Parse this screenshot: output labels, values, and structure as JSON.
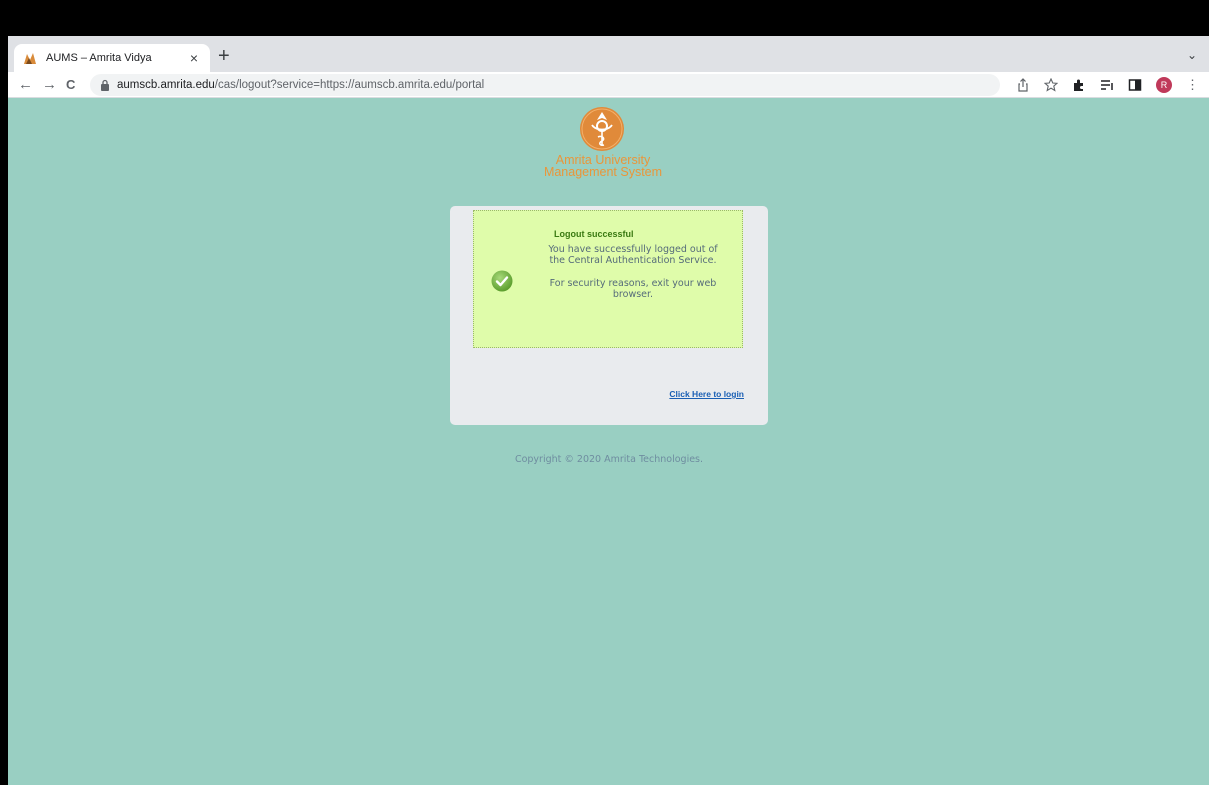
{
  "browser": {
    "tab": {
      "title": "AUMS – Amrita Vidya",
      "close": "×"
    },
    "new_tab": "+",
    "tab_list": "⌄",
    "nav": {
      "back": "←",
      "forward": "→",
      "reload": "C"
    },
    "url": {
      "domain": "aumscb.amrita.edu",
      "path": "/cas/logout?service=https://aumscb.amrita.edu/portal"
    },
    "toolbar_icons": [
      "share-icon",
      "star-icon",
      "extensions-icon",
      "reading-list-icon",
      "side-panel-icon",
      "profile-avatar",
      "menu-icon"
    ],
    "profile_initial": "R"
  },
  "page": {
    "background": "#99cfc2",
    "brand_line1": "Amrita University",
    "brand_line2": "Management System",
    "status": {
      "title": "Logout successful",
      "message": "You have successfully logged out of the Central Authentication Service.",
      "security_note": "For security reasons, exit your web browser."
    },
    "login_link": "Click Here to login",
    "copyright": "Copyright © 2020 Amrita Technologies."
  }
}
